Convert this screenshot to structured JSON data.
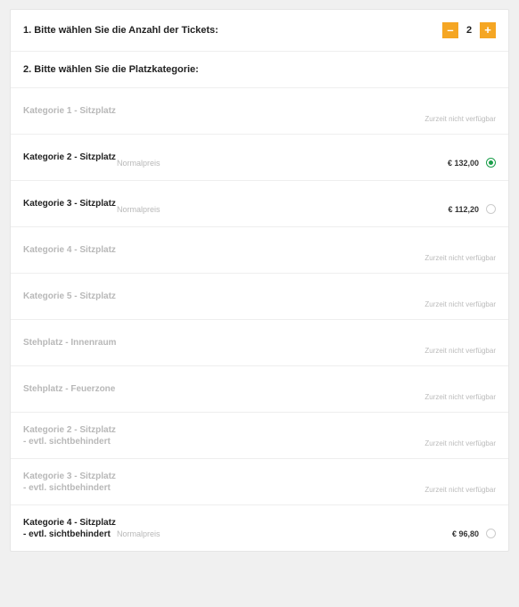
{
  "step1": {
    "label": "1. Bitte wählen Sie die Anzahl der Tickets:",
    "quantity": "2",
    "minus": "–",
    "plus": "+"
  },
  "step2": {
    "label": "2. Bitte wählen Sie die Platzkategorie:"
  },
  "unavailable_text": "Zurzeit nicht verfügbar",
  "price_type": "Normalpreis",
  "categories": [
    {
      "name": "Kategorie 1 - Sitzplatz",
      "available": false
    },
    {
      "name": "Kategorie 2 - Sitzplatz",
      "available": true,
      "price": "€ 132,00",
      "selected": true
    },
    {
      "name": "Kategorie 3 - Sitzplatz",
      "available": true,
      "price": "€ 112,20",
      "selected": false
    },
    {
      "name": "Kategorie 4 - Sitzplatz",
      "available": false
    },
    {
      "name": "Kategorie 5 - Sitzplatz",
      "available": false
    },
    {
      "name": "Stehplatz - Innenraum",
      "available": false
    },
    {
      "name": "Stehplatz - Feuerzone",
      "available": false
    },
    {
      "name": "Kategorie 2 - Sitzplatz - evtl. sichtbehindert",
      "available": false
    },
    {
      "name": "Kategorie 3 - Sitzplatz - evtl. sichtbehindert",
      "available": false
    },
    {
      "name": "Kategorie 4 - Sitzplatz - evtl. sichtbehindert",
      "available": true,
      "price": "€ 96,80",
      "selected": false
    }
  ]
}
